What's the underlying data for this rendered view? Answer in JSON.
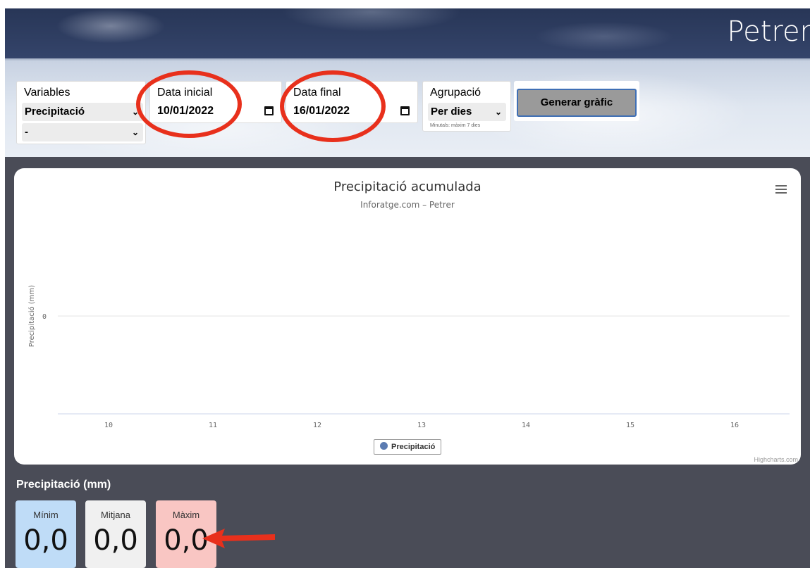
{
  "header": {
    "city": "Petrer"
  },
  "form": {
    "variables": {
      "label": "Variables",
      "selected": "Precipitació",
      "secondary": "-"
    },
    "start_date": {
      "label": "Data inicial",
      "value": "10/01/2022"
    },
    "end_date": {
      "label": "Data final",
      "value": "16/01/2022"
    },
    "grouping": {
      "label": "Agrupació",
      "selected": "Per dies",
      "note": "Minutals: màxim 7 dies"
    },
    "generate_label": "Generar gràfic"
  },
  "chart_data": {
    "type": "line",
    "title": "Precipitació acumulada",
    "subtitle": "Inforatge.com – Petrer",
    "ylabel": "Precipitació (mm)",
    "yticks": [
      "0"
    ],
    "categories": [
      "10",
      "11",
      "12",
      "13",
      "14",
      "15",
      "16"
    ],
    "series": [
      {
        "name": "Precipitació",
        "values": []
      }
    ],
    "legend": "bottom-center",
    "colors": {
      "series": "#5b7bb1",
      "grid": "#e6e6e6",
      "axis": "#ccd6eb"
    }
  },
  "chart_ui": {
    "credits": "Highcharts.com"
  },
  "stats": {
    "title": "Precipitació (mm)",
    "items": [
      {
        "label": "Mínim",
        "value": "0,0",
        "color": "#bfdcf7"
      },
      {
        "label": "Mitjana",
        "value": "0,0",
        "color": "#f0f0f0"
      },
      {
        "label": "Màxim",
        "value": "0,0",
        "color": "#f9c6c3"
      }
    ]
  },
  "annotation_color": "#e8301c"
}
